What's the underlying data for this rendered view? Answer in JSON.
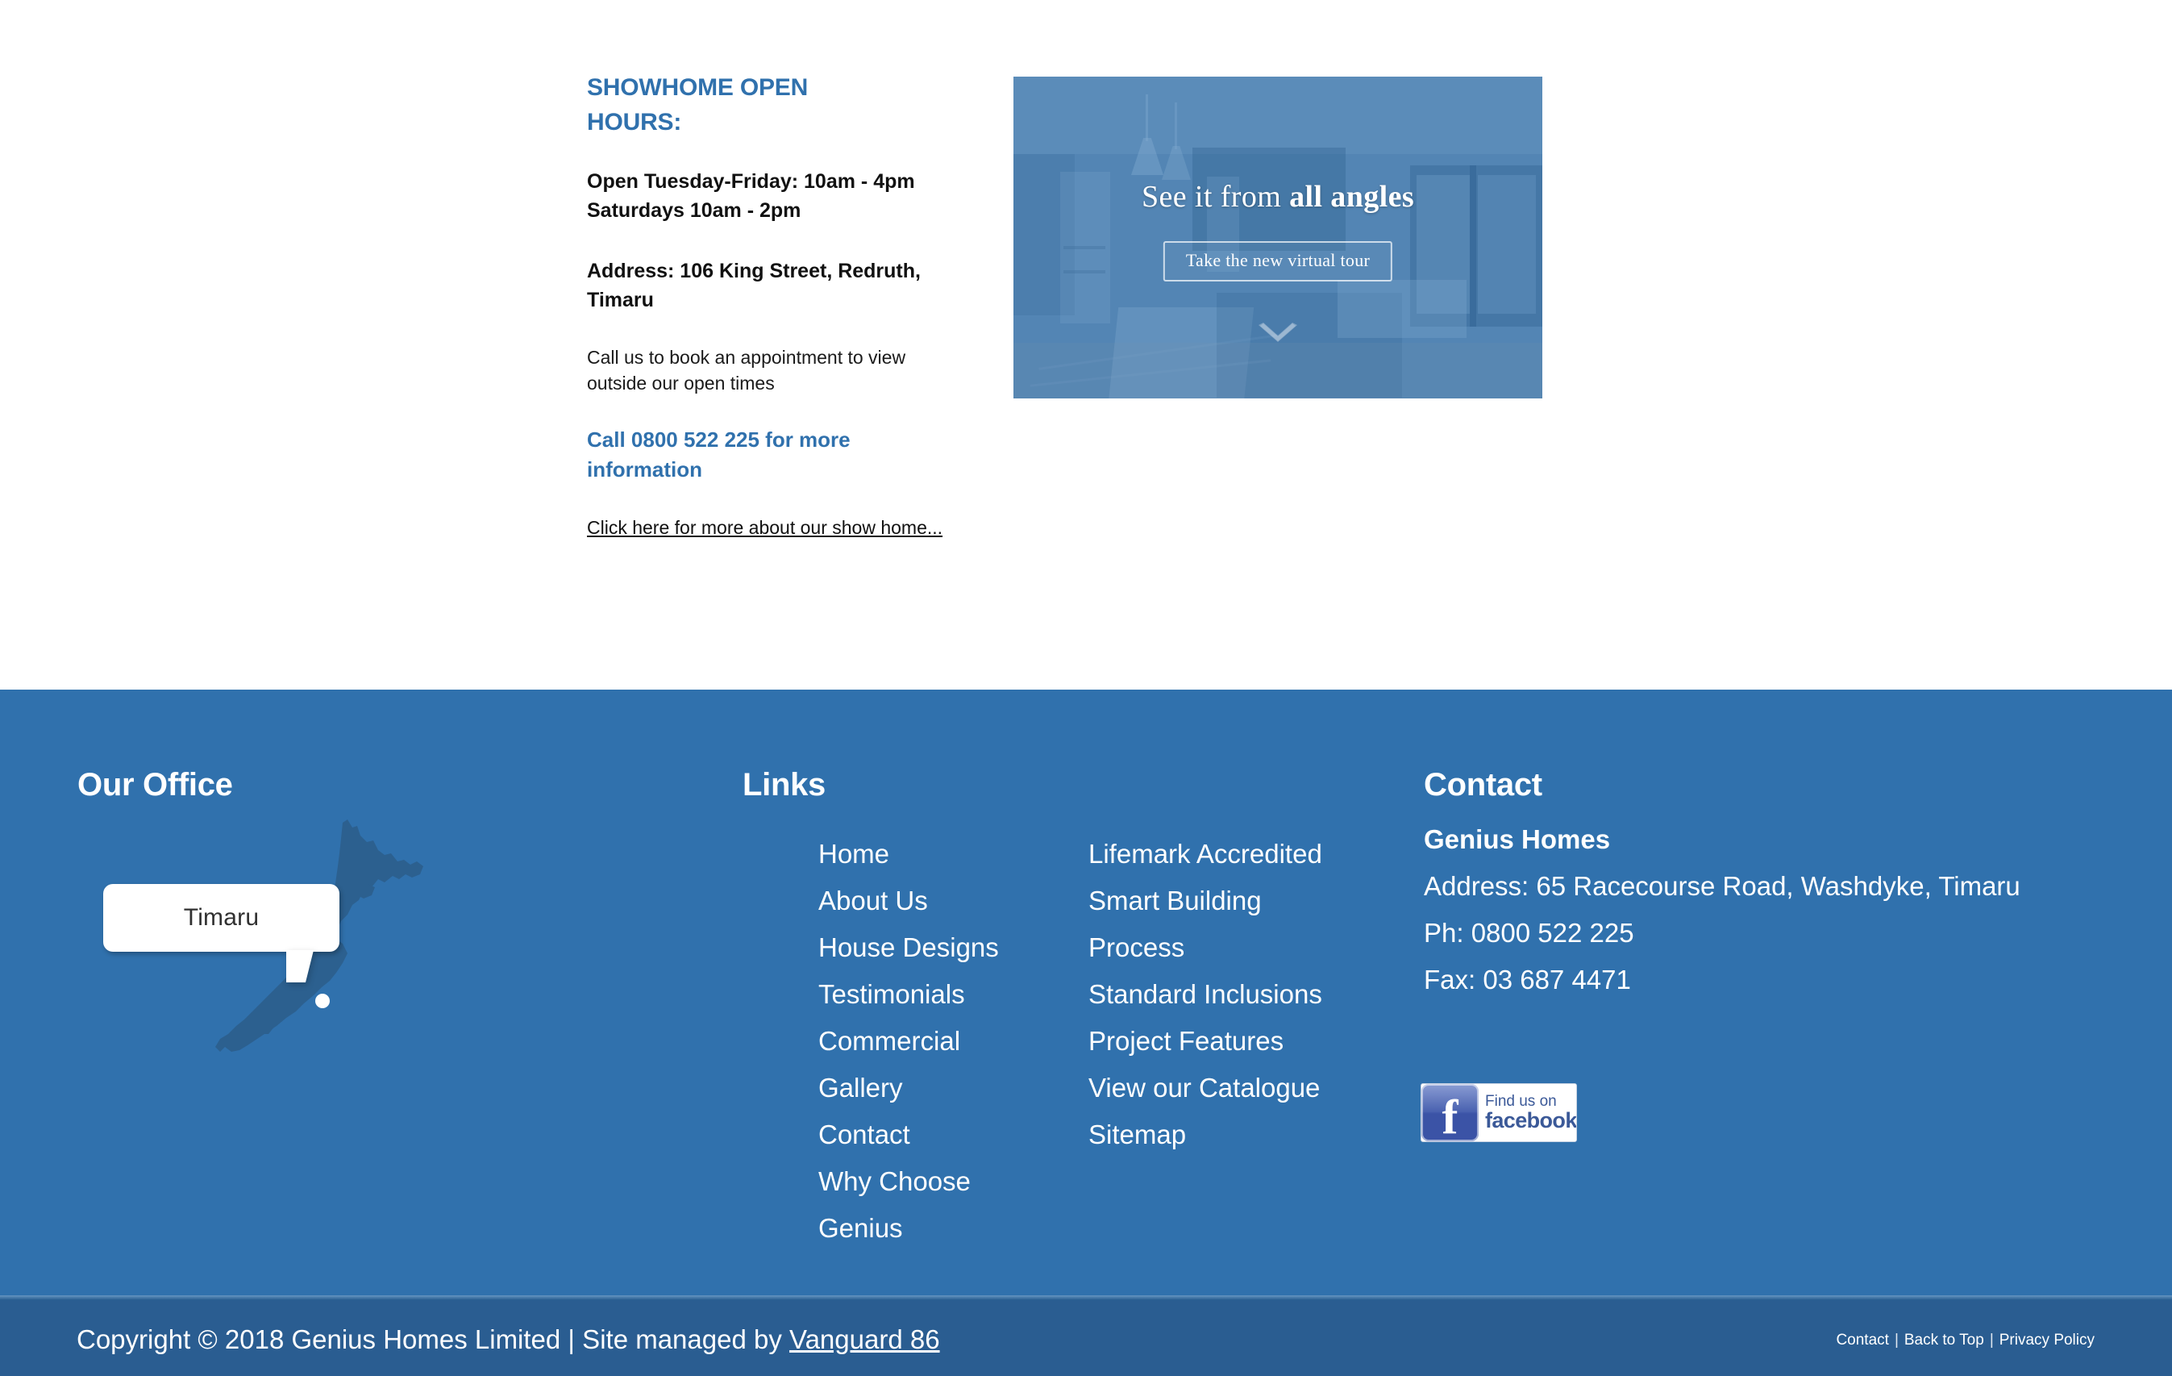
{
  "showhome": {
    "heading": "SHOWHOME OPEN HOURS:",
    "hours_line1": "Open Tuesday-Friday: 10am - 4pm",
    "hours_line2": "Saturdays 10am - 2pm",
    "address": "Address: 106 King Street, Redruth, Timaru",
    "note": "Call us to book an appointment to view outside our open times",
    "call_cta": "Call 0800 522 225 for more information",
    "more_link": "Click here for more about our show home...",
    "heading_color": "#3071AD"
  },
  "tour_promo": {
    "caption_light": "See it from ",
    "caption_bold": "all angles",
    "button_label": "Take the new virtual tour",
    "overlay_color": "#3A7BB7",
    "chevron_icon": "chevron-down-icon"
  },
  "footer": {
    "background_color": "#3071AD",
    "office": {
      "heading": "Our Office",
      "map_label": "Timaru",
      "map_icon": "new-zealand-map-icon"
    },
    "links": {
      "heading": "Links",
      "column1": [
        "Home",
        "About Us",
        "House Designs",
        "Testimonials",
        "Commercial",
        "Gallery",
        "Contact",
        "Why Choose Genius"
      ],
      "column2": [
        "Lifemark Accredited",
        "Smart Building Process",
        "Standard Inclusions",
        "Project Features",
        "View our Catalogue",
        "Sitemap"
      ]
    },
    "contact": {
      "heading": "Contact",
      "company": "Genius Homes",
      "address": "Address: 65 Racecourse Road, Washdyke, Timaru",
      "phone": "Ph: 0800 522 225",
      "fax": "Fax: 03 687 4471",
      "facebook_badge": {
        "icon": "facebook-icon",
        "line1": "Find us on",
        "line2": "facebook"
      }
    }
  },
  "bottom_bar": {
    "background_color": "#2A5D91",
    "copyright_prefix": "Copyright © 2018 Genius Homes Limited | Site managed by ",
    "managed_by": "Vanguard 86",
    "links": [
      "Contact",
      "Back to Top",
      "Privacy Policy"
    ],
    "separator": "|"
  }
}
